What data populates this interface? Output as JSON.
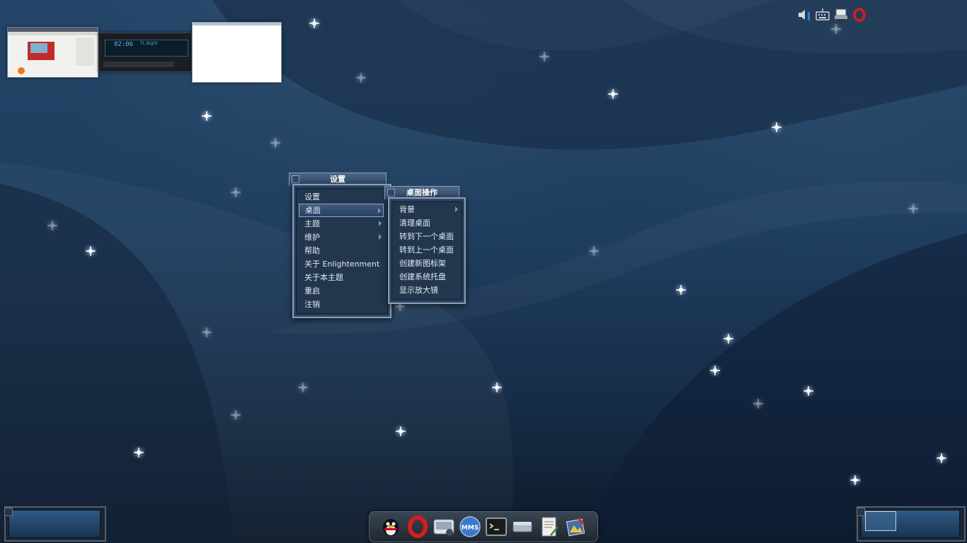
{
  "thumbnails": {
    "player_time": "02:06",
    "player_track": "TL Bight"
  },
  "settings_menu": {
    "title": "设置",
    "items": [
      {
        "label": "设置",
        "submenu": false,
        "selected": false
      },
      {
        "label": "桌面",
        "submenu": true,
        "selected": true
      },
      {
        "label": "主题",
        "submenu": true,
        "selected": false
      },
      {
        "label": "维护",
        "submenu": true,
        "selected": false
      },
      {
        "label": "帮助",
        "submenu": false,
        "selected": false
      },
      {
        "label": "关于 Enlightenment",
        "submenu": false,
        "selected": false
      },
      {
        "label": "关于本主题",
        "submenu": false,
        "selected": false
      },
      {
        "label": "重启",
        "submenu": false,
        "selected": false
      },
      {
        "label": "注销",
        "submenu": false,
        "selected": false
      }
    ]
  },
  "desktop_menu": {
    "title": "桌面操作",
    "items": [
      {
        "label": "背景",
        "submenu": true
      },
      {
        "label": "清理桌面",
        "submenu": false
      },
      {
        "label": "转到下一个桌面",
        "submenu": false
      },
      {
        "label": "转到上一个桌面",
        "submenu": false
      },
      {
        "label": "创建新图标架",
        "submenu": false
      },
      {
        "label": "创建系统托盘",
        "submenu": false
      },
      {
        "label": "显示放大镜",
        "submenu": false
      }
    ]
  },
  "systray": [
    "volume-icon",
    "keyboard-icon",
    "network-icon",
    "opera-icon"
  ],
  "dock": [
    "qq-penguin-icon",
    "opera-icon",
    "mplayer-icon",
    "mms-icon",
    "terminal-icon",
    "drive-icon",
    "text-editor-icon",
    "graphics-icon"
  ],
  "colors": {
    "desktop": "#1f3d5e",
    "menu_bg": "#2a3f5a",
    "menu_border": "#8a9db6",
    "menu_text": "#e2e9f2"
  }
}
